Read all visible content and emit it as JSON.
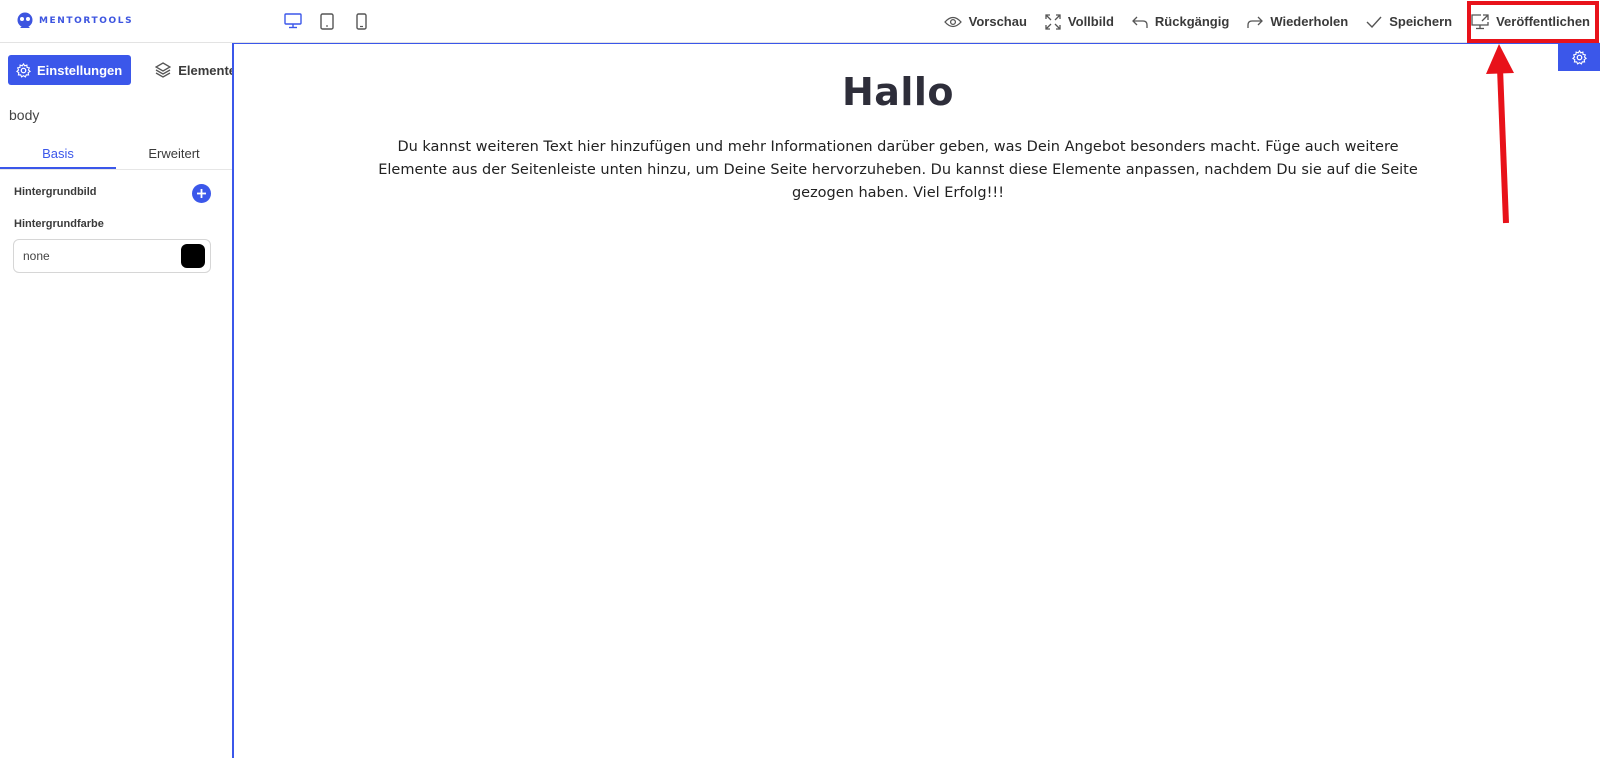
{
  "app": {
    "logo_text": "MENTORTOOLS",
    "accent": "#3b57ea",
    "annotation_color": "#e8121a"
  },
  "devices": [
    {
      "name": "desktop",
      "icon": "monitor-icon",
      "active": true
    },
    {
      "name": "tablet",
      "icon": "tablet-icon",
      "active": false
    },
    {
      "name": "mobile",
      "icon": "phone-icon",
      "active": false
    }
  ],
  "toolbar": {
    "preview_label": "Vorschau",
    "fullscreen_label": "Vollbild",
    "undo_label": "Rückgängig",
    "redo_label": "Wiederholen",
    "save_label": "Speichern",
    "publish_label": "Veröffentlichen"
  },
  "sidebar": {
    "settings_label": "Einstellungen",
    "elements_label": "Elemente",
    "selector": "body",
    "tabs": [
      {
        "label": "Basis",
        "active": true
      },
      {
        "label": "Erweitert",
        "active": false
      }
    ],
    "background_image_label": "Hintergrundbild",
    "background_color_label": "Hintergrundfarbe",
    "background_color_value": "none",
    "swatch_color": "#000000"
  },
  "canvas": {
    "title": "Hallo",
    "text": "Du kannst weiteren Text hier hinzufügen und mehr Informationen darüber geben, was Dein Angebot besonders macht. Füge auch weitere Elemente aus der Seitenleiste unten hinzu, um Deine Seite hervorzuheben. Du kannst diese Elemente anpassen, nachdem Du sie auf die Seite gezogen haben. Viel Erfolg!!!"
  }
}
